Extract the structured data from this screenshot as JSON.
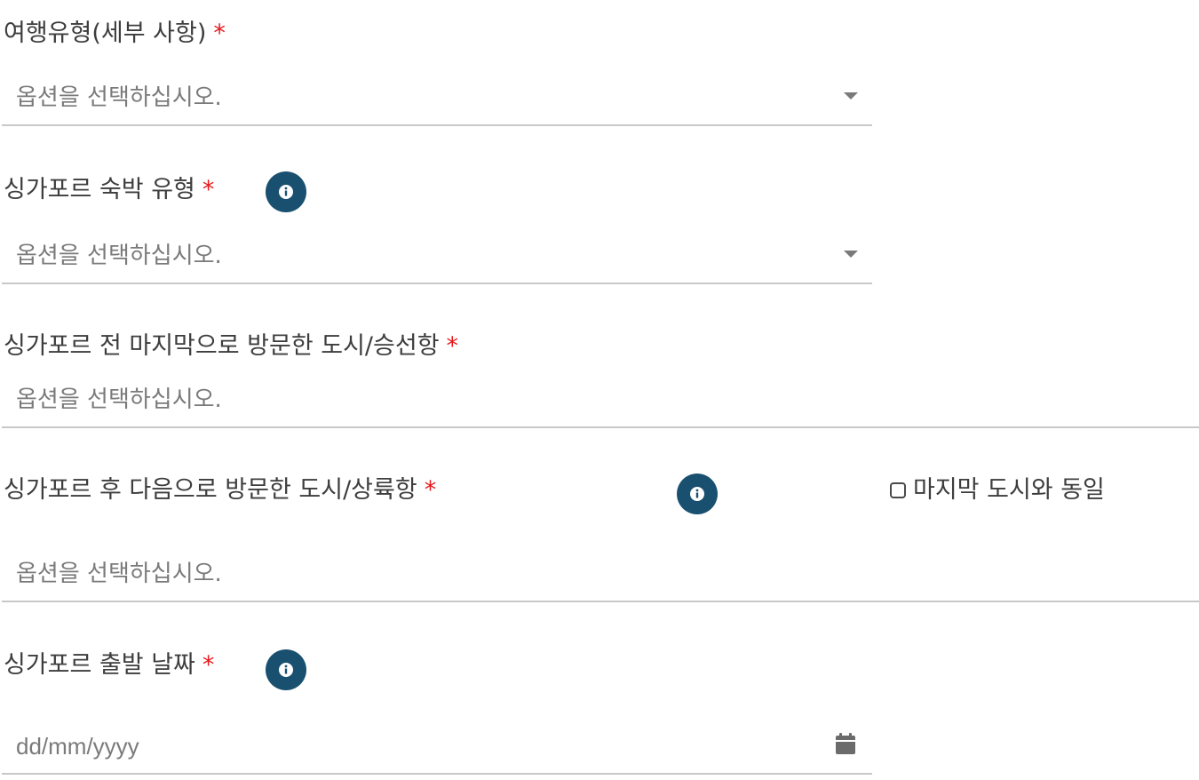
{
  "fields": [
    {
      "label": "여행유형(세부 사항)",
      "required_mark": "*",
      "placeholder": "옵션을 선택하십시오.",
      "control": "select"
    },
    {
      "label": "싱가포르 숙박 유형",
      "required_mark": "*",
      "placeholder": "옵션을 선택하십시오.",
      "control": "select",
      "icon": "info-icon"
    },
    {
      "label": "싱가포르 전 마지막으로 방문한 도시/승선항",
      "required_mark": "*",
      "placeholder": "옵션을 선택하십시오.",
      "control": "autocomplete"
    },
    {
      "label": "싱가포르 후 다음으로 방문한 도시/상륙항",
      "required_mark": "*",
      "placeholder": "옵션을 선택하십시오.",
      "control": "autocomplete",
      "icon": "info-icon",
      "checkbox": {
        "label": "마지막 도시와 동일",
        "checked": false
      }
    },
    {
      "label": "싱가포르 출발 날짜",
      "required_mark": "*",
      "placeholder": "dd/mm/yyyy",
      "control": "date",
      "icon": "info-icon",
      "trailing_icon": "calendar-icon"
    }
  ],
  "colors": {
    "required": "#e8191e",
    "info_icon_bg": "#19506f",
    "underline": "#c8c8c8",
    "placeholder": "#7a7a7a"
  }
}
